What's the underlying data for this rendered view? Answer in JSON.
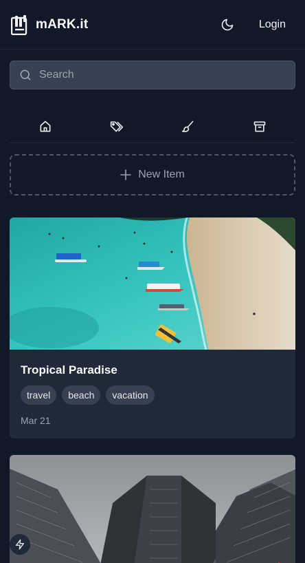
{
  "header": {
    "brand": "mARK.it",
    "login_label": "Login"
  },
  "search": {
    "placeholder": "Search"
  },
  "nav": {
    "icons": [
      "home-icon",
      "tags-icon",
      "brush-icon",
      "archive-icon"
    ]
  },
  "new_item": {
    "label": "New Item"
  },
  "cards": [
    {
      "title": "Tropical Paradise",
      "tags": [
        "travel",
        "beach",
        "vacation"
      ],
      "date": "Mar 21"
    }
  ],
  "colors": {
    "background": "#111827",
    "card": "#1f2937",
    "tag": "#374151",
    "muted": "#9ca3af"
  }
}
